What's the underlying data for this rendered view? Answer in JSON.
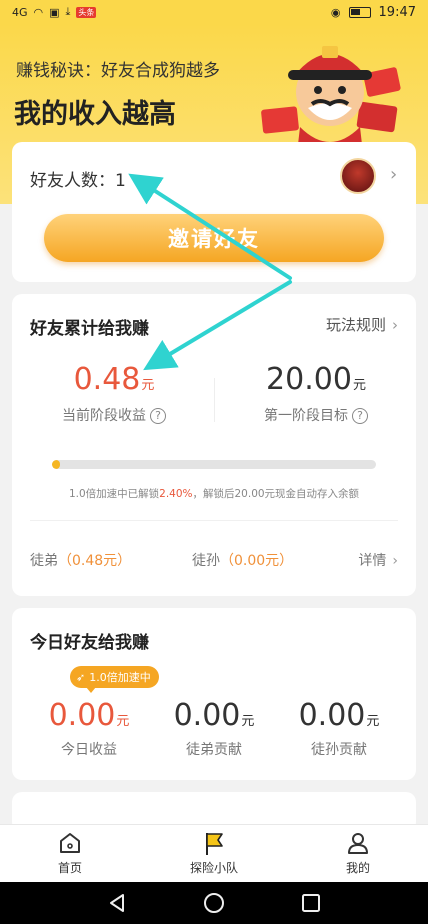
{
  "status_bar": {
    "signal": "4G",
    "notif_badge": "头条",
    "time": "19:47"
  },
  "hero": {
    "tip": "赚钱秘诀：好友合成狗越多",
    "title": "我的收入越高"
  },
  "friends": {
    "label": "好友人数：",
    "count": "1",
    "invite_label": "邀请好友"
  },
  "earn": {
    "title": "好友累计给我赚",
    "rules_label": "玩法规则",
    "current_value": "0.48",
    "current_unit": "元",
    "current_caption": "当前阶段收益",
    "target_value": "20.00",
    "target_unit": "元",
    "target_caption": "第一阶段目标",
    "progress_percent": 2.4,
    "note_prefix": "1.0倍加速中已解锁",
    "note_percent": "2.40%",
    "note_suffix": "，解锁后20.00元现金自动存入余额",
    "disciple_label": "徒弟",
    "disciple_value": "（0.48元）",
    "grand_label": "徒孙",
    "grand_value": "（0.00元）",
    "details_label": "详情"
  },
  "today": {
    "title": "今日好友给我赚",
    "boost_label": "1.0倍加速中",
    "stats": [
      {
        "value": "0.00",
        "unit": "元",
        "caption": "今日收益"
      },
      {
        "value": "0.00",
        "unit": "元",
        "caption": "徒弟贡献"
      },
      {
        "value": "0.00",
        "unit": "元",
        "caption": "徒孙贡献"
      }
    ]
  },
  "tabs": [
    {
      "label": "首页",
      "icon": "home-icon"
    },
    {
      "label": "探险小队",
      "icon": "flag-icon"
    },
    {
      "label": "我的",
      "icon": "user-icon"
    }
  ],
  "colors": {
    "brand_yellow": "#fbd84a",
    "accent_orange": "#f5a623",
    "money_red": "#e8583c",
    "annotation_teal": "#2fd3d0"
  }
}
